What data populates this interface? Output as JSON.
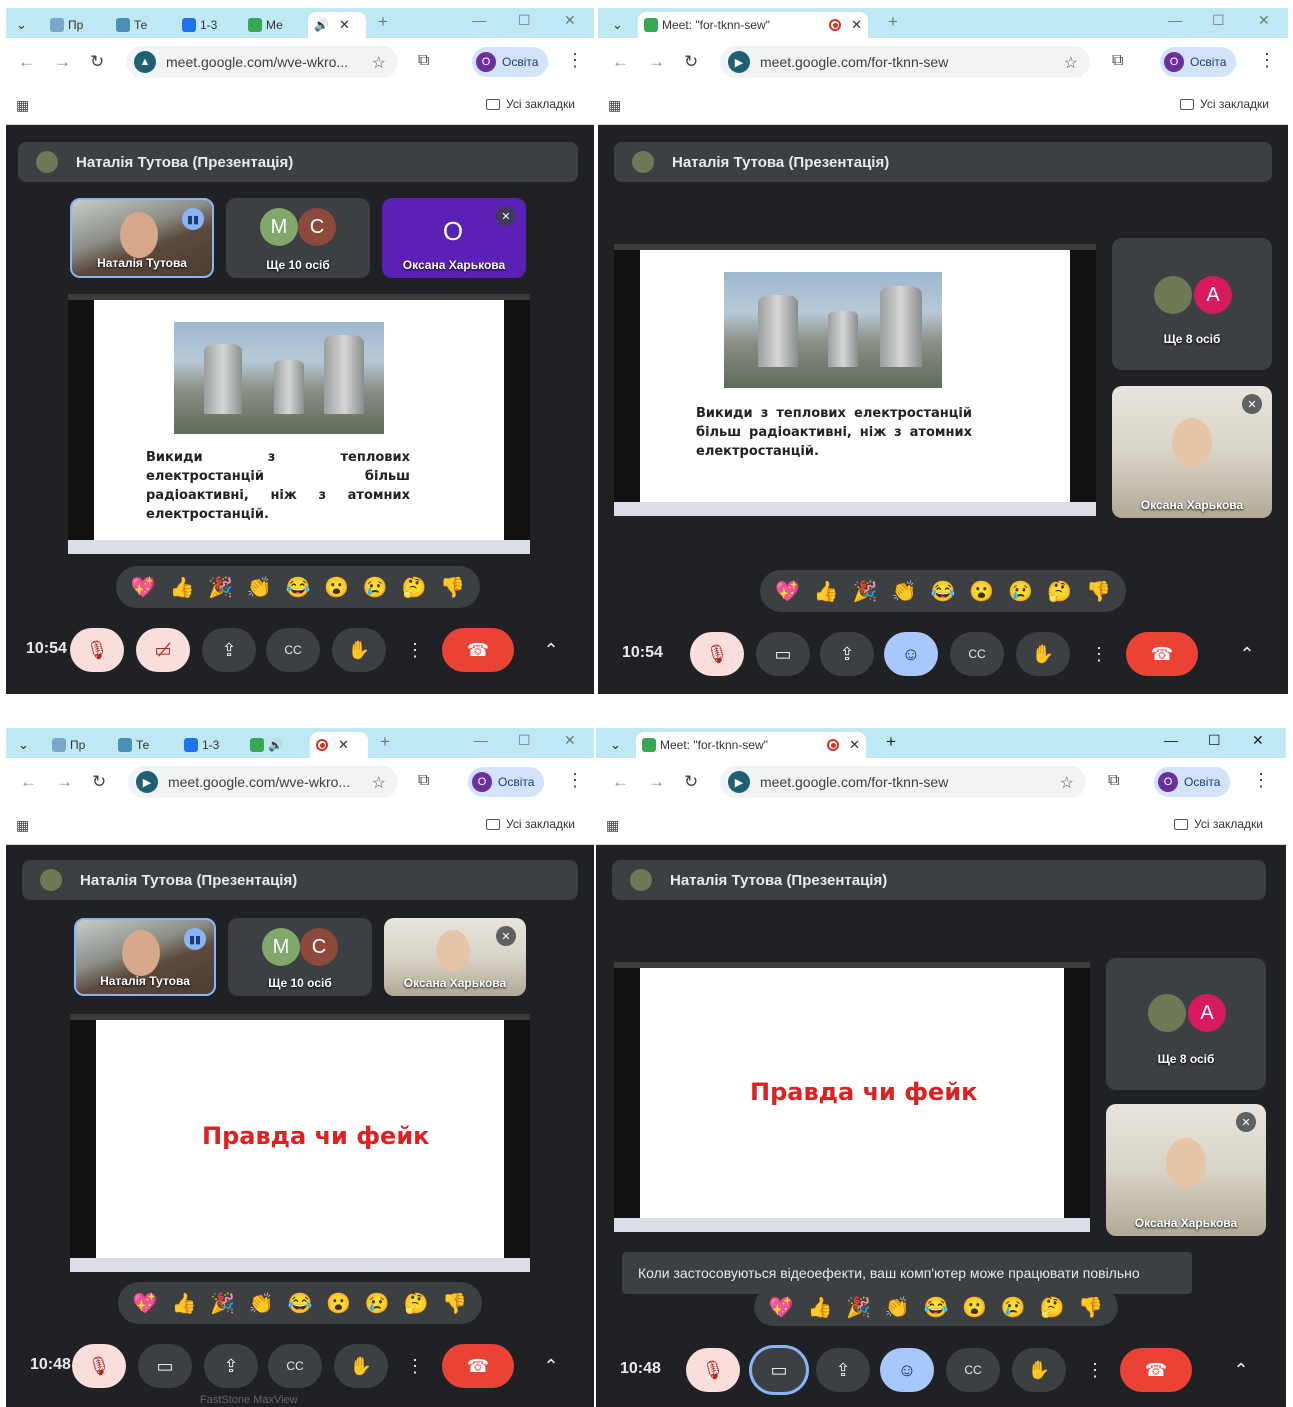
{
  "panels": [
    {
      "id": "top-left",
      "tabs": [
        {
          "label": "Пр"
        },
        {
          "label": "Те"
        },
        {
          "label": "1-3"
        },
        {
          "label": "Ме"
        }
      ],
      "url": "meet.google.com/wve-wkro...",
      "profile": "Освіта",
      "bookmarks": "Усі закладки",
      "presenter": "Наталія Тутова (Презентація)",
      "tiles": [
        {
          "name": "Наталія Тутова"
        },
        {
          "name": "Ще 10 осіб",
          "avatars": [
            "М",
            "С"
          ]
        },
        {
          "name": "Оксана Харькова",
          "avatar": "О"
        }
      ],
      "slide_text": "Викиди з теплових електростанцій більш радіоактивні, ніж з атомних електростанцій.",
      "clock": "10:54"
    },
    {
      "id": "top-right",
      "tabs": [
        {
          "label": "Meet: \"for-tknn-sew\""
        }
      ],
      "url": "meet.google.com/for-tknn-sew",
      "profile": "Освіта",
      "bookmarks": "Усі закладки",
      "presenter": "Наталія Тутова (Презентація)",
      "tiles": [
        {
          "name": "Ще 8 осіб",
          "avatar": "А"
        },
        {
          "name": "Оксана Харькова"
        }
      ],
      "slide_text": "Викиди з теплових електростанцій більш радіоактивні, ніж з атомних електростанцій.",
      "clock": "10:54"
    },
    {
      "id": "bottom-left",
      "tabs": [
        {
          "label": "Пр"
        },
        {
          "label": "Те"
        },
        {
          "label": "1-3"
        }
      ],
      "url": "meet.google.com/wve-wkro...",
      "profile": "Освіта",
      "bookmarks": "Усі закладки",
      "presenter": "Наталія Тутова (Презентація)",
      "tiles": [
        {
          "name": "Наталія Тутова"
        },
        {
          "name": "Ще 10 осіб",
          "avatars": [
            "М",
            "С"
          ]
        },
        {
          "name": "Оксана Харькова"
        }
      ],
      "slide_title": "Правда чи фейк",
      "clock": "10:48"
    },
    {
      "id": "bottom-right",
      "tabs": [
        {
          "label": "Meet: \"for-tknn-sew\""
        }
      ],
      "url": "meet.google.com/for-tknn-sew",
      "profile": "Освіта",
      "bookmarks": "Усі закладки",
      "presenter": "Наталія Тутова (Презентація)",
      "tiles": [
        {
          "name": "Ще 8 осіб",
          "avatar": "А"
        },
        {
          "name": "Оксана Харькова"
        }
      ],
      "slide_title": "Правда чи фейк",
      "toast": "Коли застосовуються відеоефекти, ваш комп'ютер може працювати повільно",
      "clock": "10:48"
    }
  ],
  "reactions": [
    "💖",
    "👍",
    "🎉",
    "👏",
    "😂",
    "😮",
    "😢",
    "🤔",
    "👎"
  ],
  "footnote": "FastStone MaxView",
  "colors": {
    "meet_bg": "#202124",
    "tile_bg": "#3c4043",
    "end_call": "#ea4335",
    "tab_strip": "#bfe8f5",
    "slide_red": "#e02020"
  }
}
